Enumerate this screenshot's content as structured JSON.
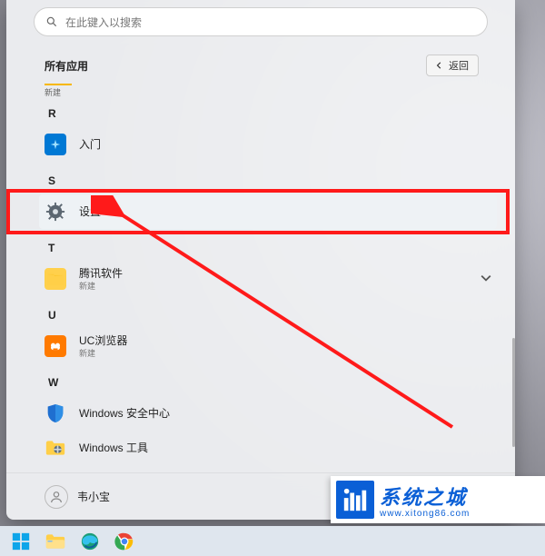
{
  "search": {
    "placeholder": "在此键入以搜索"
  },
  "header": {
    "title": "所有应用",
    "back_label": "返回"
  },
  "partial_badge": "新建",
  "sections": {
    "R": {
      "letter": "R",
      "items": [
        {
          "label": "入门"
        }
      ]
    },
    "S": {
      "letter": "S",
      "items": [
        {
          "label": "设置"
        }
      ]
    },
    "T": {
      "letter": "T",
      "items": [
        {
          "label": "腾讯软件",
          "sub": "新建"
        }
      ]
    },
    "U": {
      "letter": "U",
      "items": [
        {
          "label": "UC浏览器",
          "sub": "新建"
        }
      ]
    },
    "W": {
      "letter": "W",
      "items": [
        {
          "label": "Windows 安全中心"
        },
        {
          "label": "Windows 工具"
        }
      ]
    }
  },
  "user": {
    "name": "韦小宝"
  },
  "watermark": {
    "name": "系统之城",
    "url": "www.xitong86.com"
  }
}
